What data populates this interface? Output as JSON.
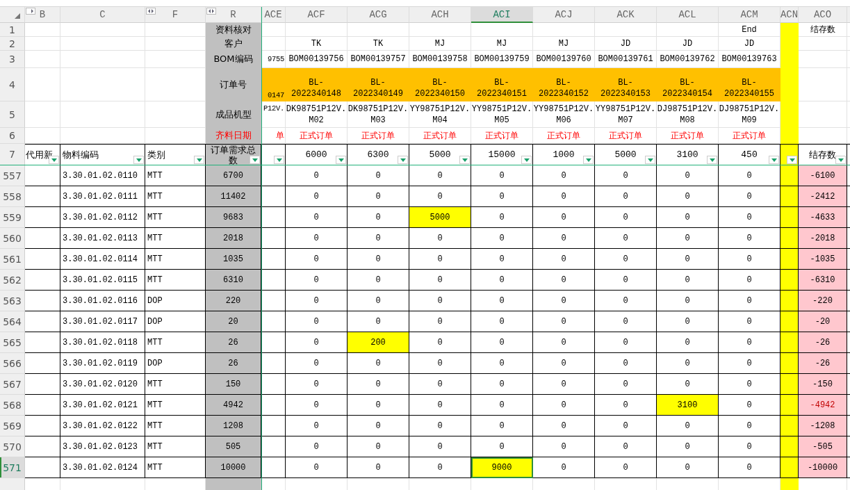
{
  "columns": [
    {
      "letter": "B",
      "selected": false
    },
    {
      "letter": "C",
      "selected": false
    },
    {
      "letter": "F",
      "selected": false
    },
    {
      "letter": "R",
      "selected": false
    },
    {
      "letter": "ACE",
      "selected": false
    },
    {
      "letter": "ACF",
      "selected": false
    },
    {
      "letter": "ACG",
      "selected": false
    },
    {
      "letter": "ACH",
      "selected": false
    },
    {
      "letter": "ACI",
      "selected": true
    },
    {
      "letter": "ACJ",
      "selected": false
    },
    {
      "letter": "ACK",
      "selected": false
    },
    {
      "letter": "ACL",
      "selected": false
    },
    {
      "letter": "ACM",
      "selected": false
    },
    {
      "letter": "ACN",
      "selected": false
    },
    {
      "letter": "ACO",
      "selected": false
    }
  ],
  "header_row_numbers": [
    "1",
    "2",
    "3",
    "4",
    "5",
    "6",
    "7"
  ],
  "row_labels": [
    {
      "text": "资料核对",
      "alert": false
    },
    {
      "text": "客户",
      "alert": false
    },
    {
      "text": "BOM编码",
      "alert": false
    },
    {
      "text": "订单号",
      "alert": false
    },
    {
      "text": "成品机型",
      "alert": false
    },
    {
      "text": "齐料日期",
      "alert": true
    },
    {
      "text": "订单需求总数",
      "alert": false
    }
  ],
  "partial_column": {
    "bom": "9755",
    "order_no": "0147",
    "model": "P12V.",
    "order_type": "单"
  },
  "order_columns": [
    {
      "customer": "TK",
      "bom": "BOM00139756",
      "order_no": "BL-\n2022340148",
      "model": "DK98751P12V.\nM02",
      "order_type": "正式订单",
      "quantity": "6000"
    },
    {
      "customer": "TK",
      "bom": "BOM00139757",
      "order_no": "BL-\n2022340149",
      "model": "DK98751P12V.\nM03",
      "order_type": "正式订单",
      "quantity": "6300"
    },
    {
      "customer": "MJ",
      "bom": "BOM00139758",
      "order_no": "BL-\n2022340150",
      "model": "YY98751P12V.\nM04",
      "order_type": "正式订单",
      "quantity": "5000"
    },
    {
      "customer": "MJ",
      "bom": "BOM00139759",
      "order_no": "BL-\n2022340151",
      "model": "YY98751P12V.\nM05",
      "order_type": "正式订单",
      "quantity": "15000"
    },
    {
      "customer": "MJ",
      "bom": "BOM00139760",
      "order_no": "BL-\n2022340152",
      "model": "YY98751P12V.\nM06",
      "order_type": "正式订单",
      "quantity": "1000"
    },
    {
      "customer": "JD",
      "bom": "BOM00139761",
      "order_no": "BL-\n2022340153",
      "model": "YY98751P12V.\nM07",
      "order_type": "正式订单",
      "quantity": "5000"
    },
    {
      "customer": "JD",
      "bom": "BOM00139762",
      "order_no": "BL-\n2022340154",
      "model": "DJ98751P12V.\nM08",
      "order_type": "正式订单",
      "quantity": "3100"
    },
    {
      "end_mark": "End",
      "customer": "JD",
      "bom": "BOM00139763",
      "order_no": "BL-\n2022340155",
      "model": "DJ98751P12V.\nM09",
      "order_type": "正式订单",
      "quantity": "450"
    }
  ],
  "balance_title": "结存数",
  "field_headers": {
    "substitute": "代用新",
    "material_code": "物料编码",
    "category": "类别",
    "balance": "结存数"
  },
  "rows": [
    {
      "number": "557",
      "selected": false,
      "code": "3.30.01.02.0110",
      "category": "MTT",
      "demand": "6700",
      "orders": [
        {
          "text": "0",
          "highlighted": false,
          "selected": false
        },
        {
          "text": "0",
          "highlighted": false,
          "selected": false
        },
        {
          "text": "0",
          "highlighted": false,
          "selected": false
        },
        {
          "text": "0",
          "highlighted": false,
          "selected": false
        },
        {
          "text": "0",
          "highlighted": false,
          "selected": false
        },
        {
          "text": "0",
          "highlighted": false,
          "selected": false
        },
        {
          "text": "0",
          "highlighted": false,
          "selected": false
        },
        {
          "text": "0",
          "highlighted": false,
          "selected": false
        }
      ],
      "balance": "-6100",
      "balance_red": false
    },
    {
      "number": "558",
      "selected": false,
      "code": "3.30.01.02.0111",
      "category": "MTT",
      "demand": "11402",
      "orders": [
        {
          "text": "0",
          "highlighted": false,
          "selected": false
        },
        {
          "text": "0",
          "highlighted": false,
          "selected": false
        },
        {
          "text": "0",
          "highlighted": false,
          "selected": false
        },
        {
          "text": "0",
          "highlighted": false,
          "selected": false
        },
        {
          "text": "0",
          "highlighted": false,
          "selected": false
        },
        {
          "text": "0",
          "highlighted": false,
          "selected": false
        },
        {
          "text": "0",
          "highlighted": false,
          "selected": false
        },
        {
          "text": "0",
          "highlighted": false,
          "selected": false
        }
      ],
      "balance": "-2412",
      "balance_red": false
    },
    {
      "number": "559",
      "selected": false,
      "code": "3.30.01.02.0112",
      "category": "MTT",
      "demand": "9683",
      "orders": [
        {
          "text": "0",
          "highlighted": false,
          "selected": false
        },
        {
          "text": "0",
          "highlighted": false,
          "selected": false
        },
        {
          "text": "5000",
          "highlighted": true,
          "selected": false
        },
        {
          "text": "0",
          "highlighted": false,
          "selected": false
        },
        {
          "text": "0",
          "highlighted": false,
          "selected": false
        },
        {
          "text": "0",
          "highlighted": false,
          "selected": false
        },
        {
          "text": "0",
          "highlighted": false,
          "selected": false
        },
        {
          "text": "0",
          "highlighted": false,
          "selected": false
        }
      ],
      "balance": "-4633",
      "balance_red": false
    },
    {
      "number": "560",
      "selected": false,
      "code": "3.30.01.02.0113",
      "category": "MTT",
      "demand": "2018",
      "orders": [
        {
          "text": "0",
          "highlighted": false,
          "selected": false
        },
        {
          "text": "0",
          "highlighted": false,
          "selected": false
        },
        {
          "text": "0",
          "highlighted": false,
          "selected": false
        },
        {
          "text": "0",
          "highlighted": false,
          "selected": false
        },
        {
          "text": "0",
          "highlighted": false,
          "selected": false
        },
        {
          "text": "0",
          "highlighted": false,
          "selected": false
        },
        {
          "text": "0",
          "highlighted": false,
          "selected": false
        },
        {
          "text": "0",
          "highlighted": false,
          "selected": false
        }
      ],
      "balance": "-2018",
      "balance_red": false
    },
    {
      "number": "561",
      "selected": false,
      "code": "3.30.01.02.0114",
      "category": "MTT",
      "demand": "1035",
      "orders": [
        {
          "text": "0",
          "highlighted": false,
          "selected": false
        },
        {
          "text": "0",
          "highlighted": false,
          "selected": false
        },
        {
          "text": "0",
          "highlighted": false,
          "selected": false
        },
        {
          "text": "0",
          "highlighted": false,
          "selected": false
        },
        {
          "text": "0",
          "highlighted": false,
          "selected": false
        },
        {
          "text": "0",
          "highlighted": false,
          "selected": false
        },
        {
          "text": "0",
          "highlighted": false,
          "selected": false
        },
        {
          "text": "0",
          "highlighted": false,
          "selected": false
        }
      ],
      "balance": "-1035",
      "balance_red": false
    },
    {
      "number": "562",
      "selected": false,
      "code": "3.30.01.02.0115",
      "category": "MTT",
      "demand": "6310",
      "orders": [
        {
          "text": "0",
          "highlighted": false,
          "selected": false
        },
        {
          "text": "0",
          "highlighted": false,
          "selected": false
        },
        {
          "text": "0",
          "highlighted": false,
          "selected": false
        },
        {
          "text": "0",
          "highlighted": false,
          "selected": false
        },
        {
          "text": "0",
          "highlighted": false,
          "selected": false
        },
        {
          "text": "0",
          "highlighted": false,
          "selected": false
        },
        {
          "text": "0",
          "highlighted": false,
          "selected": false
        },
        {
          "text": "0",
          "highlighted": false,
          "selected": false
        }
      ],
      "balance": "-6310",
      "balance_red": false
    },
    {
      "number": "563",
      "selected": false,
      "code": "3.30.01.02.0116",
      "category": "DOP",
      "demand": "220",
      "orders": [
        {
          "text": "0",
          "highlighted": false,
          "selected": false
        },
        {
          "text": "0",
          "highlighted": false,
          "selected": false
        },
        {
          "text": "0",
          "highlighted": false,
          "selected": false
        },
        {
          "text": "0",
          "highlighted": false,
          "selected": false
        },
        {
          "text": "0",
          "highlighted": false,
          "selected": false
        },
        {
          "text": "0",
          "highlighted": false,
          "selected": false
        },
        {
          "text": "0",
          "highlighted": false,
          "selected": false
        },
        {
          "text": "0",
          "highlighted": false,
          "selected": false
        }
      ],
      "balance": "-220",
      "balance_red": false
    },
    {
      "number": "564",
      "selected": false,
      "code": "3.30.01.02.0117",
      "category": "DOP",
      "demand": "20",
      "orders": [
        {
          "text": "0",
          "highlighted": false,
          "selected": false
        },
        {
          "text": "0",
          "highlighted": false,
          "selected": false
        },
        {
          "text": "0",
          "highlighted": false,
          "selected": false
        },
        {
          "text": "0",
          "highlighted": false,
          "selected": false
        },
        {
          "text": "0",
          "highlighted": false,
          "selected": false
        },
        {
          "text": "0",
          "highlighted": false,
          "selected": false
        },
        {
          "text": "0",
          "highlighted": false,
          "selected": false
        },
        {
          "text": "0",
          "highlighted": false,
          "selected": false
        }
      ],
      "balance": "-20",
      "balance_red": false
    },
    {
      "number": "565",
      "selected": false,
      "code": "3.30.01.02.0118",
      "category": "MTT",
      "demand": "26",
      "orders": [
        {
          "text": "0",
          "highlighted": false,
          "selected": false
        },
        {
          "text": "200",
          "highlighted": true,
          "selected": false
        },
        {
          "text": "0",
          "highlighted": false,
          "selected": false
        },
        {
          "text": "0",
          "highlighted": false,
          "selected": false
        },
        {
          "text": "0",
          "highlighted": false,
          "selected": false
        },
        {
          "text": "0",
          "highlighted": false,
          "selected": false
        },
        {
          "text": "0",
          "highlighted": false,
          "selected": false
        },
        {
          "text": "0",
          "highlighted": false,
          "selected": false
        }
      ],
      "balance": "-26",
      "balance_red": false
    },
    {
      "number": "566",
      "selected": false,
      "code": "3.30.01.02.0119",
      "category": "DOP",
      "demand": "26",
      "orders": [
        {
          "text": "0",
          "highlighted": false,
          "selected": false
        },
        {
          "text": "0",
          "highlighted": false,
          "selected": false
        },
        {
          "text": "0",
          "highlighted": false,
          "selected": false
        },
        {
          "text": "0",
          "highlighted": false,
          "selected": false
        },
        {
          "text": "0",
          "highlighted": false,
          "selected": false
        },
        {
          "text": "0",
          "highlighted": false,
          "selected": false
        },
        {
          "text": "0",
          "highlighted": false,
          "selected": false
        },
        {
          "text": "0",
          "highlighted": false,
          "selected": false
        }
      ],
      "balance": "-26",
      "balance_red": false
    },
    {
      "number": "567",
      "selected": false,
      "code": "3.30.01.02.0120",
      "category": "MTT",
      "demand": "150",
      "orders": [
        {
          "text": "0",
          "highlighted": false,
          "selected": false
        },
        {
          "text": "0",
          "highlighted": false,
          "selected": false
        },
        {
          "text": "0",
          "highlighted": false,
          "selected": false
        },
        {
          "text": "0",
          "highlighted": false,
          "selected": false
        },
        {
          "text": "0",
          "highlighted": false,
          "selected": false
        },
        {
          "text": "0",
          "highlighted": false,
          "selected": false
        },
        {
          "text": "0",
          "highlighted": false,
          "selected": false
        },
        {
          "text": "0",
          "highlighted": false,
          "selected": false
        }
      ],
      "balance": "-150",
      "balance_red": false
    },
    {
      "number": "568",
      "selected": false,
      "code": "3.30.01.02.0121",
      "category": "MTT",
      "demand": "4942",
      "orders": [
        {
          "text": "0",
          "highlighted": false,
          "selected": false
        },
        {
          "text": "0",
          "highlighted": false,
          "selected": false
        },
        {
          "text": "0",
          "highlighted": false,
          "selected": false
        },
        {
          "text": "0",
          "highlighted": false,
          "selected": false
        },
        {
          "text": "0",
          "highlighted": false,
          "selected": false
        },
        {
          "text": "0",
          "highlighted": false,
          "selected": false
        },
        {
          "text": "3100",
          "highlighted": true,
          "selected": false
        },
        {
          "text": "0",
          "highlighted": false,
          "selected": false
        }
      ],
      "balance": "-4942",
      "balance_red": true
    },
    {
      "number": "569",
      "selected": false,
      "code": "3.30.01.02.0122",
      "category": "MTT",
      "demand": "1208",
      "orders": [
        {
          "text": "0",
          "highlighted": false,
          "selected": false
        },
        {
          "text": "0",
          "highlighted": false,
          "selected": false
        },
        {
          "text": "0",
          "highlighted": false,
          "selected": false
        },
        {
          "text": "0",
          "highlighted": false,
          "selected": false
        },
        {
          "text": "0",
          "highlighted": false,
          "selected": false
        },
        {
          "text": "0",
          "highlighted": false,
          "selected": false
        },
        {
          "text": "0",
          "highlighted": false,
          "selected": false
        },
        {
          "text": "0",
          "highlighted": false,
          "selected": false
        }
      ],
      "balance": "-1208",
      "balance_red": false
    },
    {
      "number": "570",
      "selected": false,
      "code": "3.30.01.02.0123",
      "category": "MTT",
      "demand": "505",
      "orders": [
        {
          "text": "0",
          "highlighted": false,
          "selected": false
        },
        {
          "text": "0",
          "highlighted": false,
          "selected": false
        },
        {
          "text": "0",
          "highlighted": false,
          "selected": false
        },
        {
          "text": "0",
          "highlighted": false,
          "selected": false
        },
        {
          "text": "0",
          "highlighted": false,
          "selected": false
        },
        {
          "text": "0",
          "highlighted": false,
          "selected": false
        },
        {
          "text": "0",
          "highlighted": false,
          "selected": false
        },
        {
          "text": "0",
          "highlighted": false,
          "selected": false
        }
      ],
      "balance": "-505",
      "balance_red": false
    },
    {
      "number": "571",
      "selected": true,
      "code": "3.30.01.02.0124",
      "category": "MTT",
      "demand": "10000",
      "orders": [
        {
          "text": "0",
          "highlighted": false,
          "selected": false
        },
        {
          "text": "0",
          "highlighted": false,
          "selected": false
        },
        {
          "text": "0",
          "highlighted": false,
          "selected": false
        },
        {
          "text": "9000",
          "highlighted": true,
          "selected": true
        },
        {
          "text": "0",
          "highlighted": false,
          "selected": false
        },
        {
          "text": "0",
          "highlighted": false,
          "selected": false
        },
        {
          "text": "0",
          "highlighted": false,
          "selected": false
        },
        {
          "text": "0",
          "highlighted": false,
          "selected": false
        }
      ],
      "balance": "-10000",
      "balance_red": false
    }
  ],
  "next_row_visible": true
}
